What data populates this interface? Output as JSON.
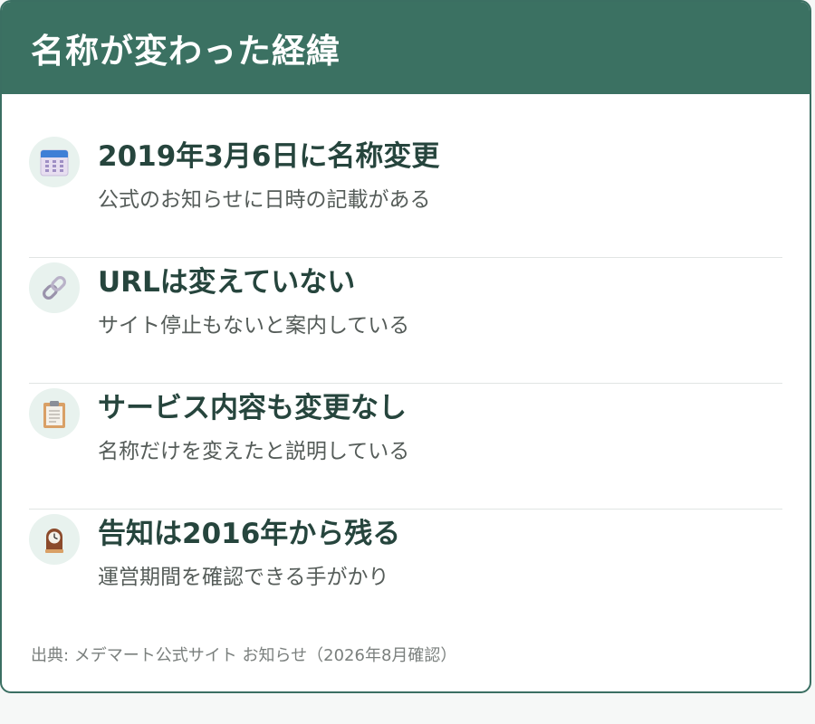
{
  "header": {
    "title": "名称が変わった経緯"
  },
  "items": [
    {
      "icon": "calendar-icon",
      "title": "2019年3月6日に名称変更",
      "desc": "公式のお知らせに日時の記載がある"
    },
    {
      "icon": "link-icon",
      "title": "URLは変えていない",
      "desc": "サイト停止もないと案内している"
    },
    {
      "icon": "clipboard-icon",
      "title": "サービス内容も変更なし",
      "desc": "名称だけを変えたと説明している"
    },
    {
      "icon": "clock-icon",
      "title": "告知は2016年から残る",
      "desc": "運営期間を確認できる手がかり"
    }
  ],
  "footer": {
    "source": "出典: メデマート公式サイト お知らせ（2026年8月確認）"
  },
  "colors": {
    "header_bg": "#3b7162",
    "border": "#3b6f62",
    "title_text": "#26453d",
    "icon_bg": "#e8f2ee"
  }
}
